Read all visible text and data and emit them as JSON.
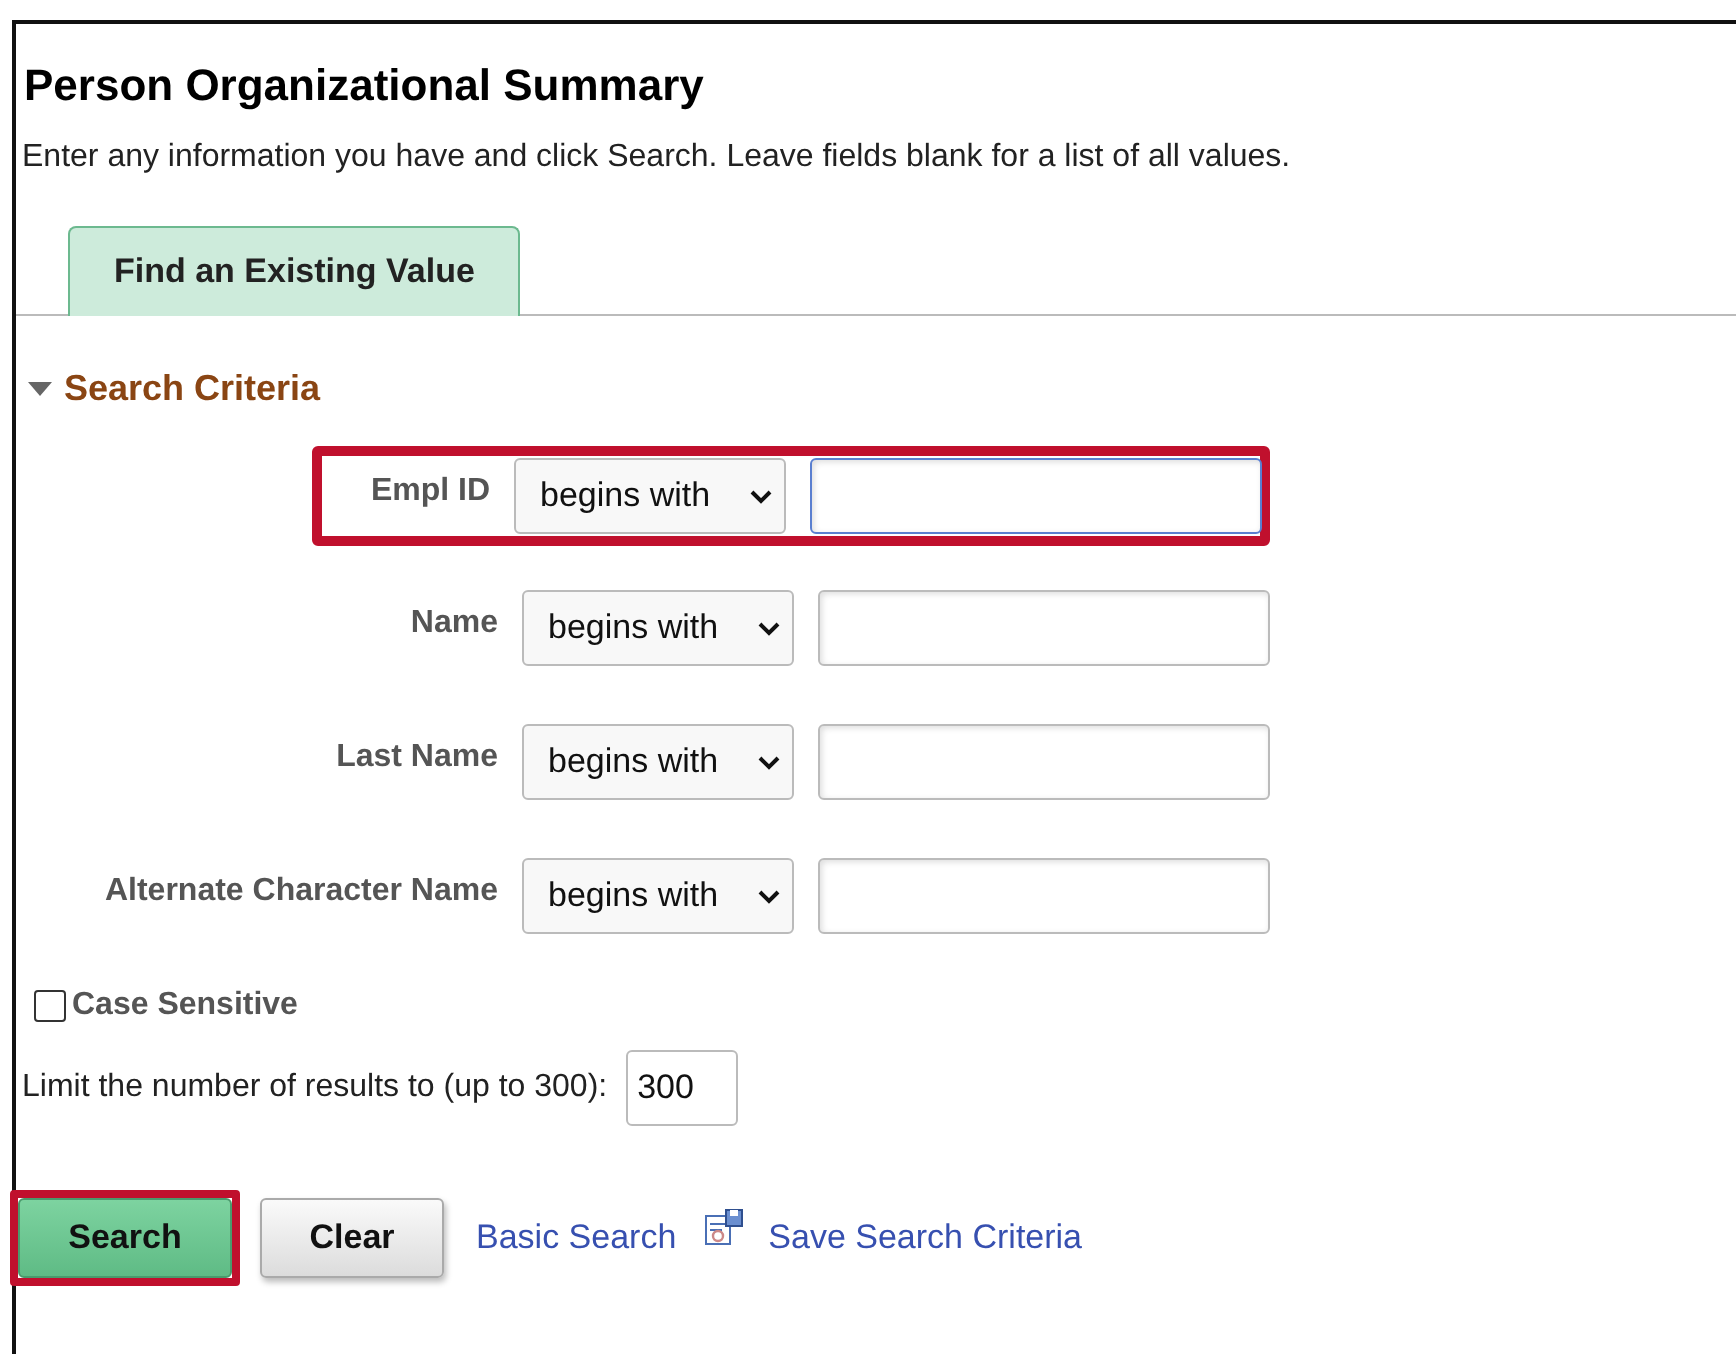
{
  "page": {
    "title": "Person Organizational Summary",
    "instructions": "Enter any information you have and click Search. Leave fields blank for a list of all values."
  },
  "tabs": [
    {
      "label": "Find an Existing Value",
      "selected": true
    }
  ],
  "section": {
    "title": "Search Criteria",
    "expanded": true
  },
  "fields": [
    {
      "label": "Empl ID",
      "operator": "begins with",
      "highlighted": true
    },
    {
      "label": "Name",
      "operator": "begins with",
      "highlighted": false
    },
    {
      "label": "Last Name",
      "operator": "begins with",
      "highlighted": false
    },
    {
      "label": "Alternate Character Name",
      "operator": "begins with",
      "highlighted": false
    }
  ],
  "case_sensitive": {
    "label": "Case Sensitive",
    "checked": false
  },
  "limit": {
    "label": "Limit the number of results to (up to 300):",
    "value": "300"
  },
  "buttons": [
    {
      "label": "Search",
      "kind": "primary",
      "highlighted": true
    },
    {
      "label": "Clear",
      "kind": "secondary",
      "highlighted": false
    }
  ],
  "links": [
    {
      "label": "Basic Search",
      "kind": "plain"
    },
    {
      "label": "Save Search Criteria",
      "kind": "save"
    }
  ]
}
